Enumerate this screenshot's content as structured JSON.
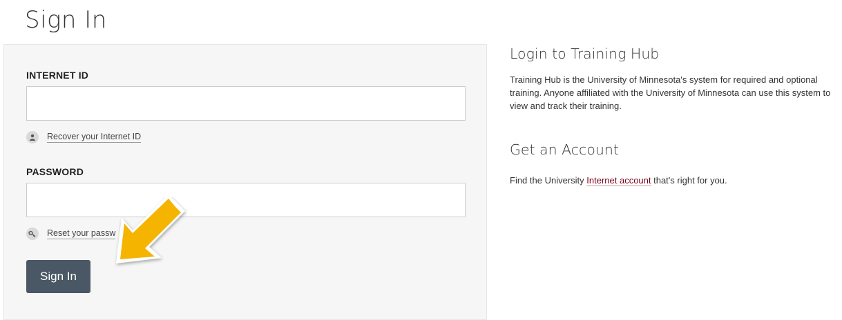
{
  "page": {
    "title": "Sign In"
  },
  "form": {
    "internet_id_label": "INTERNET ID",
    "internet_id_value": "",
    "recover_link": "Recover your Internet ID",
    "password_label": "PASSWORD",
    "password_value": "",
    "reset_link": "Reset your passw",
    "signin_button": "Sign In"
  },
  "info": {
    "login_heading": "Login to Training Hub",
    "login_text": "Training Hub is the University of Minnesota's system for required and optional training. Anyone affiliated with the University of Minnesota can use this system to view and track their training.",
    "account_heading": "Get an Account",
    "account_text_before": "Find the University ",
    "account_link": "Internet account",
    "account_text_after": " that's right for you."
  },
  "icons": {
    "recover": "user-icon",
    "reset": "key-icon",
    "annotation": "arrow-icon"
  },
  "colors": {
    "button": "#4a5866",
    "link": "#7a0019",
    "arrow": "#f5b400",
    "panel": "#f6f6f6"
  }
}
